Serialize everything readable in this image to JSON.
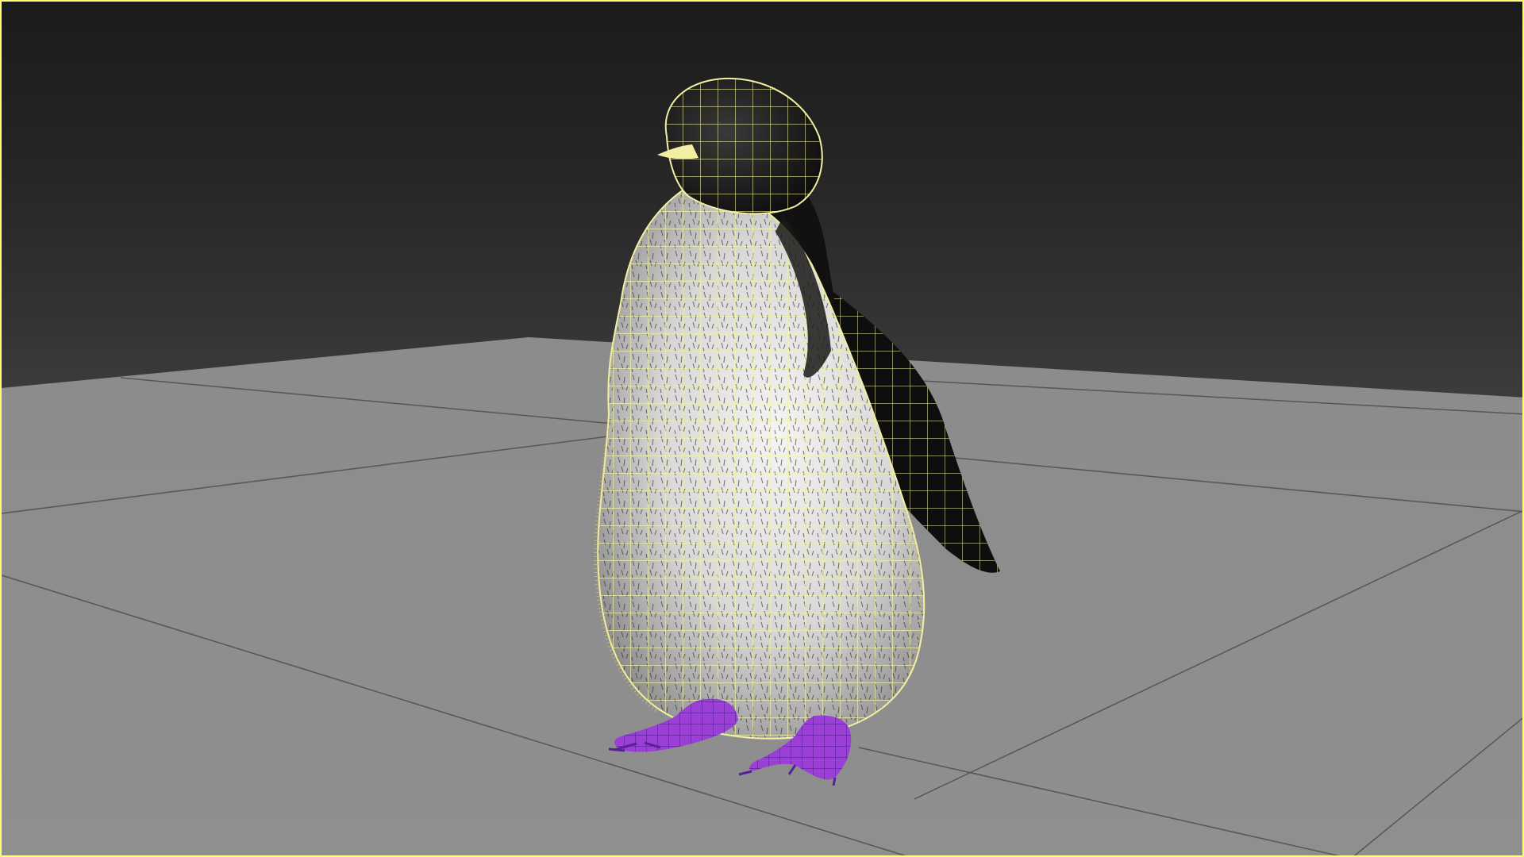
{
  "viewport": {
    "background_top": "#1b1b1b",
    "background_horizon": "#454545",
    "border_color": "#ffff7a"
  },
  "scene": {
    "ground_plane_color": "#8a8a8a",
    "grid_line_color": "#5a5a5a",
    "wireframe_color": "#f2f0a0",
    "selected_feet_color": "#9b3fd6",
    "object": "penguin-mesh",
    "display_mode": "shaded-with-wireframe"
  }
}
